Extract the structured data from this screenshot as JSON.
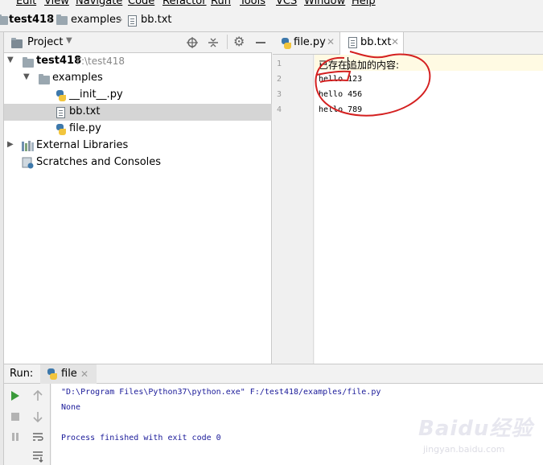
{
  "menu": [
    "Edit",
    "View",
    "Navigate",
    "Code",
    "Refactor",
    "Run",
    "Tools",
    "VCS",
    "Window",
    "Help"
  ],
  "breadcrumb": {
    "project": "test418",
    "folder": "examples",
    "file": "bb.txt"
  },
  "project_panel": {
    "title": "Project",
    "tree": [
      {
        "label": "test418",
        "path": "F:\\test418"
      },
      {
        "label": "examples"
      },
      {
        "label": "__init__.py"
      },
      {
        "label": "bb.txt"
      },
      {
        "label": "file.py"
      },
      {
        "label": "External Libraries"
      },
      {
        "label": "Scratches and Consoles"
      }
    ]
  },
  "editor": {
    "tabs": [
      {
        "label": "file.py"
      },
      {
        "label": "bb.txt"
      }
    ],
    "line_numbers": [
      "1",
      "2",
      "3",
      "4"
    ],
    "lines": [
      "已存在追加的内容:",
      "hello 123",
      "hello 456",
      "hello 789"
    ]
  },
  "run": {
    "label": "Run:",
    "tab": "file",
    "output": [
      "\"D:\\Program Files\\Python37\\python.exe\" F:/test418/examples/file.py",
      "None",
      "",
      "Process finished with exit code 0"
    ]
  },
  "watermark": {
    "brand": "Baidu经验",
    "url": "jingyan.baidu.com"
  },
  "colors": {
    "annotation": "#d42020",
    "selection": "#d5d5d5",
    "current_line": "#fffae3"
  }
}
